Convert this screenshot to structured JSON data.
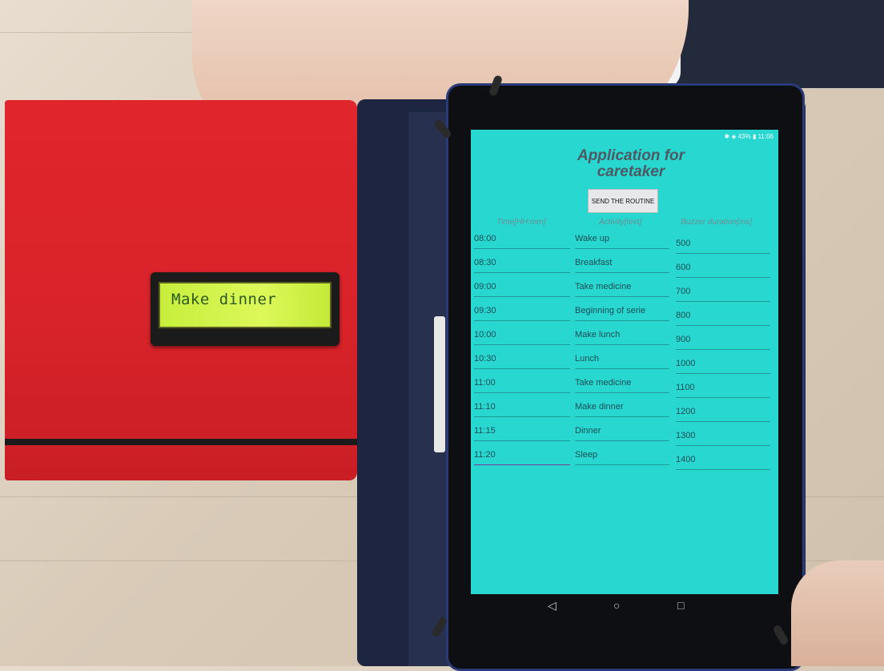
{
  "lcd": {
    "text": "Make dinner"
  },
  "status_bar": {
    "text": "✱ ◈ 43% ▮ 11:06"
  },
  "app": {
    "title_line1": "Application for",
    "title_line2": "caretaker",
    "send_button": "SEND THE ROUTINE"
  },
  "table": {
    "headers": {
      "time": "Time[HH:mm]",
      "activity": "Activity[text]",
      "buzzer": "Buzzer duration[ms]"
    },
    "rows": [
      {
        "time": "08:00",
        "activity": "Wake up",
        "buzzer": "500"
      },
      {
        "time": "08:30",
        "activity": "Breakfast",
        "buzzer": "600"
      },
      {
        "time": "09:00",
        "activity": "Take medicine",
        "buzzer": "700"
      },
      {
        "time": "09:30",
        "activity": "Beginning of serie",
        "buzzer": "800"
      },
      {
        "time": "10:00",
        "activity": "Make lunch",
        "buzzer": "900"
      },
      {
        "time": "10:30",
        "activity": "Lunch",
        "buzzer": "1000"
      },
      {
        "time": "11:00",
        "activity": "Take medicine",
        "buzzer": "1100"
      },
      {
        "time": "11:10",
        "activity": "Make dinner",
        "buzzer": "1200"
      },
      {
        "time": "11:15",
        "activity": "Dinner",
        "buzzer": "1300"
      },
      {
        "time": "11:20",
        "activity": "Sleep",
        "buzzer": "1400"
      }
    ]
  },
  "navbar": {
    "back_icon": "◁",
    "home_icon": "○",
    "recents_icon": "□"
  },
  "colors": {
    "screen_bg": "#28d7d0",
    "armband": "#d9232a",
    "lcd": "#d2f44c"
  }
}
